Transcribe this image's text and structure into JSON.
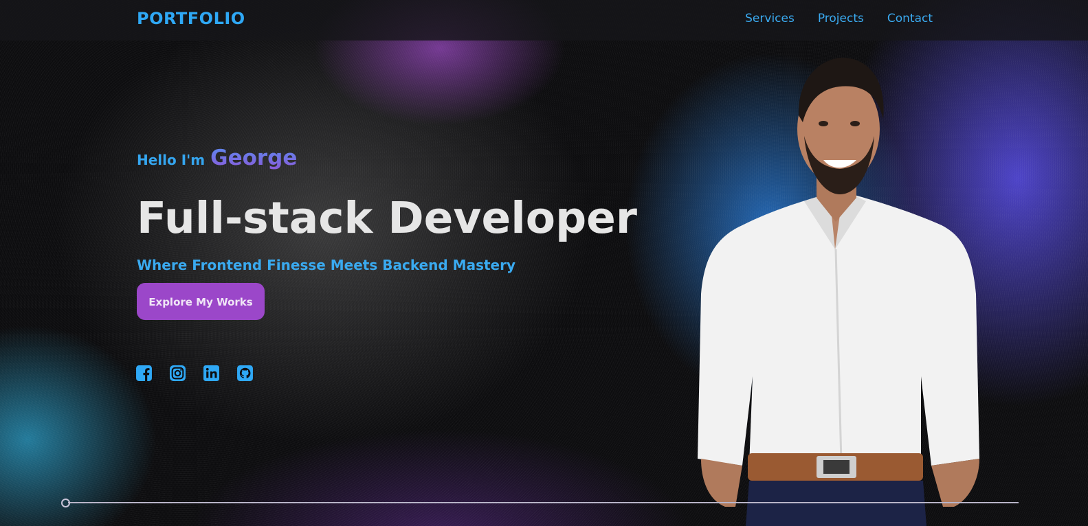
{
  "header": {
    "logo": "PORTFOLIO",
    "nav": [
      {
        "label": "Services"
      },
      {
        "label": "Projects"
      },
      {
        "label": "Contact"
      }
    ]
  },
  "hero": {
    "greeting": "Hello I'm",
    "name": "George",
    "title": "Full-stack Developer",
    "subtitle": "Where Frontend Finesse Meets Backend Mastery",
    "cta_label": "Explore My Works"
  },
  "socials": [
    {
      "icon": "facebook-icon"
    },
    {
      "icon": "instagram-icon"
    },
    {
      "icon": "linkedin-icon"
    },
    {
      "icon": "github-icon"
    }
  ],
  "colors": {
    "accent": "#2fa8f5",
    "button": "#9b47c9",
    "title": "#e6e6e6"
  }
}
